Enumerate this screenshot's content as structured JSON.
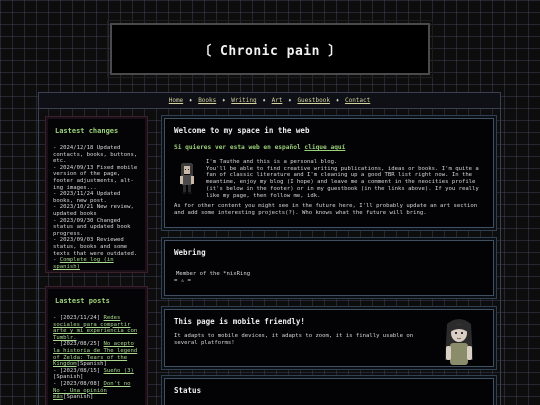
{
  "header": {
    "title": "〔 Chronic pain 〕"
  },
  "nav": {
    "links": [
      "Home",
      "Books",
      "Writing",
      "Art",
      "Guestbook",
      "Contact"
    ],
    "separator": "♦"
  },
  "sidebar": {
    "changes": {
      "title": "Lastest changes",
      "text": "- 2024/12/18 Updated contacts, books, buttons, etc.\n- 2024/09/13 Fixed mobile version of the page, footer adjustments, alt-ing images...\n- 2023/11/24 Updated books, new post.\n- 2023/10/21 New review, updated books\n- 2023/09/30 Changed status and updated book progress.\n- 2023/09/03 Reviewed status, books and some texts that were outdated.\n- ",
      "full_log_link": "Complete log (in spanish)"
    },
    "posts": {
      "title": "Lastest posts",
      "items": [
        {
          "prefix": "- [2023/11/24] ",
          "link": "Redes sociales para compartir arte y mi experiencia con Tumblr.",
          "suffix": ""
        },
        {
          "prefix": "- [2023/08/25] ",
          "link": "No acepto la historia de The legend of Zelda: Tears of the Kingdom",
          "suffix": "[Spanish]"
        },
        {
          "prefix": "- [2023/08/15] ",
          "link": "Sueño (3)",
          "suffix": "[Spanish]"
        },
        {
          "prefix": "- [2023/08/08] ",
          "link": "Don't no No - Una opinión más",
          "suffix": "[Spanish]"
        }
      ]
    }
  },
  "main": {
    "welcome": {
      "title": "Welcome to my space in the web",
      "spanish_prefix": "Si quieres ver esta web en español ",
      "spanish_link": "clique aquí",
      "intro": "I'm Tauthe and this is a personal blog.\nYou'll be able to find creative writing publications, ideas or books. I'm quite a fan of classic literature and I'm cleaning up a good TBR list right now. In the meantime, enjoy my blog (I hope) and leave me a comment in the neocities profile (it's below in the footer) or in my guestbook (in the links above). If you really like my page, then follow me, idk.",
      "outro": "As for other content you might see in the future here, I'll probably update an art section and add some interesting projects(?). Who knows what the future will bring."
    },
    "webring": {
      "title": "Webring",
      "member_text": "Member of the *nixRing",
      "icons": "= ⚠ ="
    },
    "mobile": {
      "title": "This page is mobile friendly!",
      "text": "It adapts to mobile devices, it adapts to zoom, it is finally usable on several platforms!"
    },
    "status": {
      "title": "Status"
    }
  },
  "colors": {
    "accent_green": "#9bd07a",
    "background": "#0d0d0d",
    "panel_border": "#405060"
  }
}
